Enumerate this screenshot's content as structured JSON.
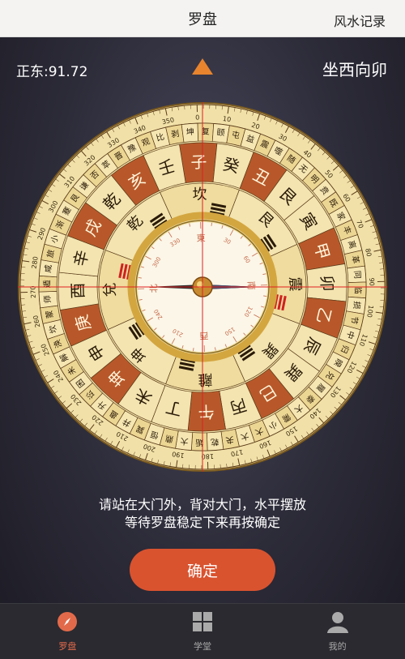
{
  "nav": {
    "title": "罗盘",
    "right_link": "风水记录"
  },
  "reading": {
    "label": "正东:91.72"
  },
  "direction": "坐西向卯",
  "instructions": {
    "line1": "请站在大门外，背对大门，水平摆放",
    "line2": "等待罗盘稳定下来再按确定"
  },
  "confirm_label": "确定",
  "tabs": [
    {
      "label": "罗盘",
      "icon": "compass-icon",
      "active": true
    },
    {
      "label": "学堂",
      "icon": "grid-icon",
      "active": false
    },
    {
      "label": "我的",
      "icon": "user-icon",
      "active": false
    }
  ],
  "compass": {
    "heading_deg": 91.72,
    "inner_dial_labels": [
      "東",
      "南",
      "西",
      "北"
    ],
    "inner_dial_numbers": [
      "0",
      "30",
      "60",
      "90",
      "120",
      "150",
      "180",
      "210",
      "240",
      "270",
      "300",
      "330"
    ],
    "mountains": [
      "子",
      "癸",
      "丑",
      "艮",
      "寅",
      "甲",
      "卯",
      "乙",
      "辰",
      "巽",
      "巳",
      "丙",
      "午",
      "丁",
      "未",
      "坤",
      "申",
      "庚",
      "酉",
      "辛",
      "戌",
      "乾",
      "亥",
      "壬"
    ],
    "trigrams": [
      "坎",
      "艮",
      "震",
      "巽",
      "離",
      "坤",
      "兌",
      "乾"
    ],
    "degree_labels": [
      "0",
      "10",
      "20",
      "30",
      "40",
      "50",
      "60",
      "70",
      "80",
      "90",
      "100",
      "110",
      "120",
      "130",
      "140",
      "150",
      "160",
      "170",
      "180",
      "190",
      "200",
      "210",
      "220",
      "230",
      "240",
      "250",
      "260",
      "270",
      "280",
      "290",
      "300",
      "310",
      "320",
      "330",
      "340",
      "350"
    ],
    "hexagram_ring": [
      "复",
      "颐",
      "屯",
      "益",
      "震",
      "噬",
      "随",
      "无",
      "明",
      "贲",
      "既",
      "家",
      "丰",
      "离",
      "革",
      "同",
      "临",
      "损",
      "节",
      "中",
      "归",
      "睽",
      "兑",
      "履",
      "泰",
      "大",
      "需",
      "小",
      "大",
      "大",
      "夬",
      "乾",
      "姤",
      "大",
      "鼎",
      "恒",
      "巽",
      "井",
      "蛊",
      "升",
      "讼",
      "困",
      "未",
      "解",
      "涣",
      "坎",
      "蒙",
      "师",
      "遁",
      "咸",
      "旅",
      "小",
      "渐",
      "蹇",
      "艮",
      "谦",
      "否",
      "萃",
      "晋",
      "豫",
      "观",
      "比",
      "剥",
      "坤"
    ],
    "colors": {
      "ring": "#e9d38e",
      "accent": "#b8582a",
      "gold": "#d4a640",
      "crosshair": "#e02020"
    }
  }
}
